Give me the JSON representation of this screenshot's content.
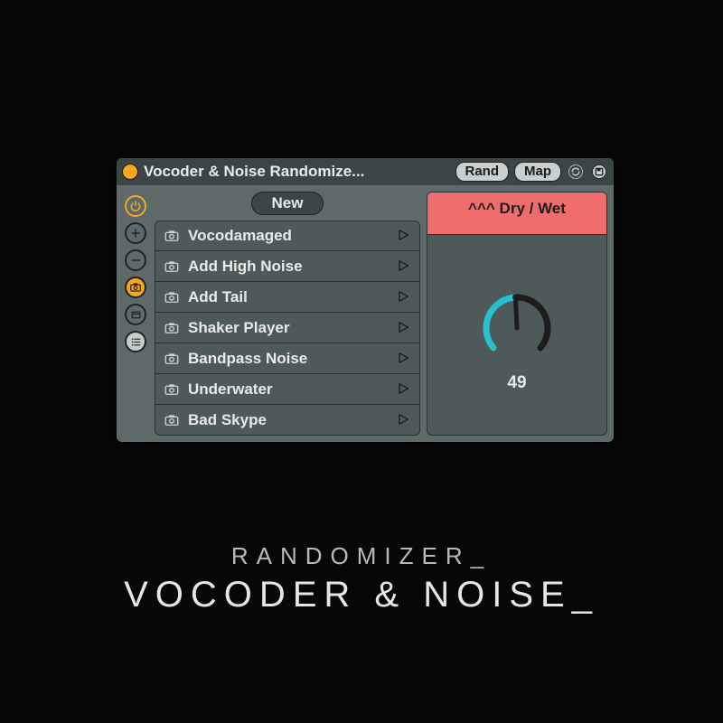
{
  "titlebar": {
    "title": "Vocoder & Noise Randomize...",
    "rand": "Rand",
    "map": "Map"
  },
  "new_button": "New",
  "presets": [
    {
      "label": "Vocodamaged"
    },
    {
      "label": "Add High Noise"
    },
    {
      "label": "Add Tail"
    },
    {
      "label": "Shaker Player"
    },
    {
      "label": "Bandpass Noise"
    },
    {
      "label": "Underwater"
    },
    {
      "label": "Bad Skype"
    }
  ],
  "panel": {
    "header": "^^^ Dry / Wet",
    "value": "49",
    "percent": 49
  },
  "caption": {
    "small": "RANDOMIZER_",
    "big": "VOCODER & NOISE_"
  },
  "colors": {
    "accent": "#f5a623",
    "knob_active": "#26c0cf",
    "panel_header": "#ef6d6d"
  }
}
